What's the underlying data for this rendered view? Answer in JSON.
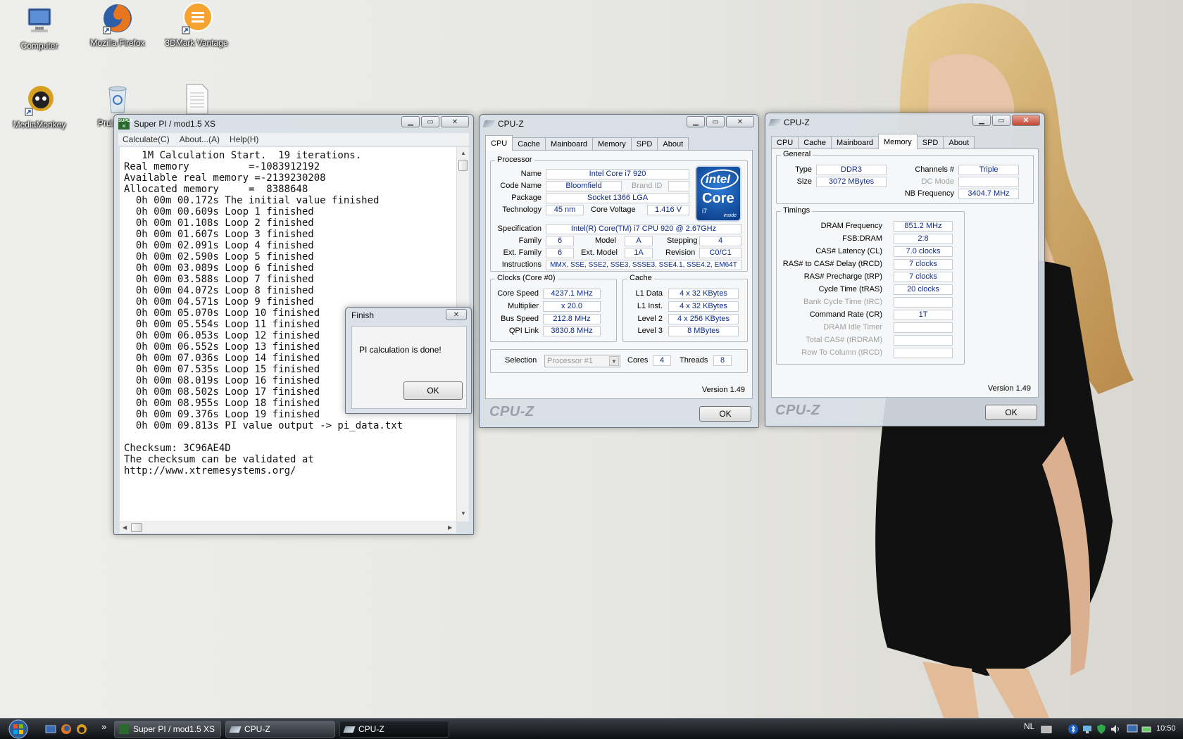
{
  "desktop": {
    "icons": [
      {
        "label": "Computer"
      },
      {
        "label": "Mozilla Firefox"
      },
      {
        "label": "3DMark Vantage"
      },
      {
        "label": "MediaMonkey"
      },
      {
        "label": "Prul"
      },
      {
        "label": ""
      }
    ]
  },
  "superpi": {
    "title": "Super PI / mod1.5 XS",
    "menu": [
      "Calculate(C)",
      "About...(A)",
      "Help(H)"
    ],
    "lines": [
      "   1M Calculation Start.  19 iterations.",
      "Real memory          =-1083912192",
      "Available real memory =-2139230208",
      "Allocated memory     =  8388648",
      "  0h 00m 00.172s The initial value finished",
      "  0h 00m 00.609s Loop 1 finished",
      "  0h 00m 01.108s Loop 2 finished",
      "  0h 00m 01.607s Loop 3 finished",
      "  0h 00m 02.091s Loop 4 finished",
      "  0h 00m 02.590s Loop 5 finished",
      "  0h 00m 03.089s Loop 6 finished",
      "  0h 00m 03.588s Loop 7 finished",
      "  0h 00m 04.072s Loop 8 finished",
      "  0h 00m 04.571s Loop 9 finished",
      "  0h 00m 05.070s Loop 10 finished",
      "  0h 00m 05.554s Loop 11 finished",
      "  0h 00m 06.053s Loop 12 finished",
      "  0h 00m 06.552s Loop 13 finished",
      "  0h 00m 07.036s Loop 14 finished",
      "  0h 00m 07.535s Loop 15 finished",
      "  0h 00m 08.019s Loop 16 finished",
      "  0h 00m 08.502s Loop 17 finished",
      "  0h 00m 08.955s Loop 18 finished",
      "  0h 00m 09.376s Loop 19 finished",
      "  0h 00m 09.813s PI value output -> pi_data.txt",
      "",
      "Checksum: 3C96AE4D",
      "The checksum can be validated at",
      "http://www.xtremesystems.org/"
    ]
  },
  "finish": {
    "title": "Finish",
    "message": "PI calculation is done!",
    "ok": "OK"
  },
  "cpuz_cpu": {
    "title": "CPU-Z",
    "tabs": [
      "CPU",
      "Cache",
      "Mainboard",
      "Memory",
      "SPD",
      "About"
    ],
    "processor_group": "Processor",
    "name_label": "Name",
    "name": "Intel Core i7 920",
    "codename_label": "Code Name",
    "codename": "Bloomfield",
    "brandid_label": "Brand ID",
    "package_label": "Package",
    "package": "Socket 1366 LGA",
    "technology_label": "Technology",
    "technology": "45 nm",
    "voltage_label": "Core Voltage",
    "voltage": "1.416 V",
    "spec_label": "Specification",
    "spec": "Intel(R) Core(TM) i7 CPU        920  @ 2.67GHz",
    "family_label": "Family",
    "family": "6",
    "model_label": "Model",
    "model": "A",
    "stepping_label": "Stepping",
    "stepping": "4",
    "extfamily_label": "Ext. Family",
    "extfamily": "6",
    "extmodel_label": "Ext. Model",
    "extmodel": "1A",
    "revision_label": "Revision",
    "revision": "C0/C1",
    "instructions_label": "Instructions",
    "instructions": "MMX, SSE, SSE2, SSE3, SSSE3, SSE4.1, SSE4.2, EM64T",
    "clocks_group": "Clocks (Core #0)",
    "corespeed_label": "Core Speed",
    "corespeed": "4237.1 MHz",
    "multiplier_label": "Multiplier",
    "multiplier": "x 20.0",
    "busspeed_label": "Bus Speed",
    "busspeed": "212.8 MHz",
    "qpi_label": "QPI Link",
    "qpi": "3830.8 MHz",
    "cache_group": "Cache",
    "l1d_label": "L1 Data",
    "l1d": "4 x 32 KBytes",
    "l1i_label": "L1 Inst.",
    "l1i": "4 x 32 KBytes",
    "l2_label": "Level 2",
    "l2": "4 x 256 KBytes",
    "l3_label": "Level 3",
    "l3": "8 MBytes",
    "selection_label": "Selection",
    "selection": "Processor #1",
    "cores_label": "Cores",
    "cores": "4",
    "threads_label": "Threads",
    "threads": "8",
    "version": "Version 1.49",
    "logo": "CPU-Z",
    "ok": "OK",
    "intel_logo": {
      "top": "intel",
      "middle": "Core",
      "bottom": "i7",
      "inside": "inside"
    }
  },
  "cpuz_mem": {
    "title": "CPU-Z",
    "tabs": [
      "CPU",
      "Cache",
      "Mainboard",
      "Memory",
      "SPD",
      "About"
    ],
    "general_group": "General",
    "type_label": "Type",
    "type": "DDR3",
    "size_label": "Size",
    "size": "3072 MBytes",
    "channels_label": "Channels #",
    "channels": "Triple",
    "dcmode_label": "DC Mode",
    "nbfreq_label": "NB Frequency",
    "nbfreq": "3404.7 MHz",
    "timings_group": "Timings",
    "dramfreq_label": "DRAM Frequency",
    "dramfreq": "851.2 MHz",
    "fsbdram_label": "FSB:DRAM",
    "fsbdram": "2:8",
    "cl_label": "CAS# Latency (CL)",
    "cl": "7.0 clocks",
    "trcd_label": "RAS# to CAS# Delay (tRCD)",
    "trcd": "7 clocks",
    "trp_label": "RAS# Precharge (tRP)",
    "trp": "7 clocks",
    "tras_label": "Cycle Time (tRAS)",
    "tras": "20 clocks",
    "trc_label": "Bank Cycle Time (tRC)",
    "cr_label": "Command Rate (CR)",
    "cr": "1T",
    "idle_label": "DRAM Idle Timer",
    "trdram_label": "Total CAS# (tRDRAM)",
    "rcd_label": "Row To Column (tRCD)",
    "version": "Version 1.49",
    "logo": "CPU-Z",
    "ok": "OK"
  },
  "taskbar": {
    "buttons": [
      "Super PI / mod1.5 XS",
      "CPU-Z",
      "CPU-Z"
    ],
    "lang": "NL",
    "clock": "10:50",
    "chevron": "»"
  },
  "colors": {
    "value_text": "#0a2a88",
    "taskbar": "#1a1d22"
  }
}
